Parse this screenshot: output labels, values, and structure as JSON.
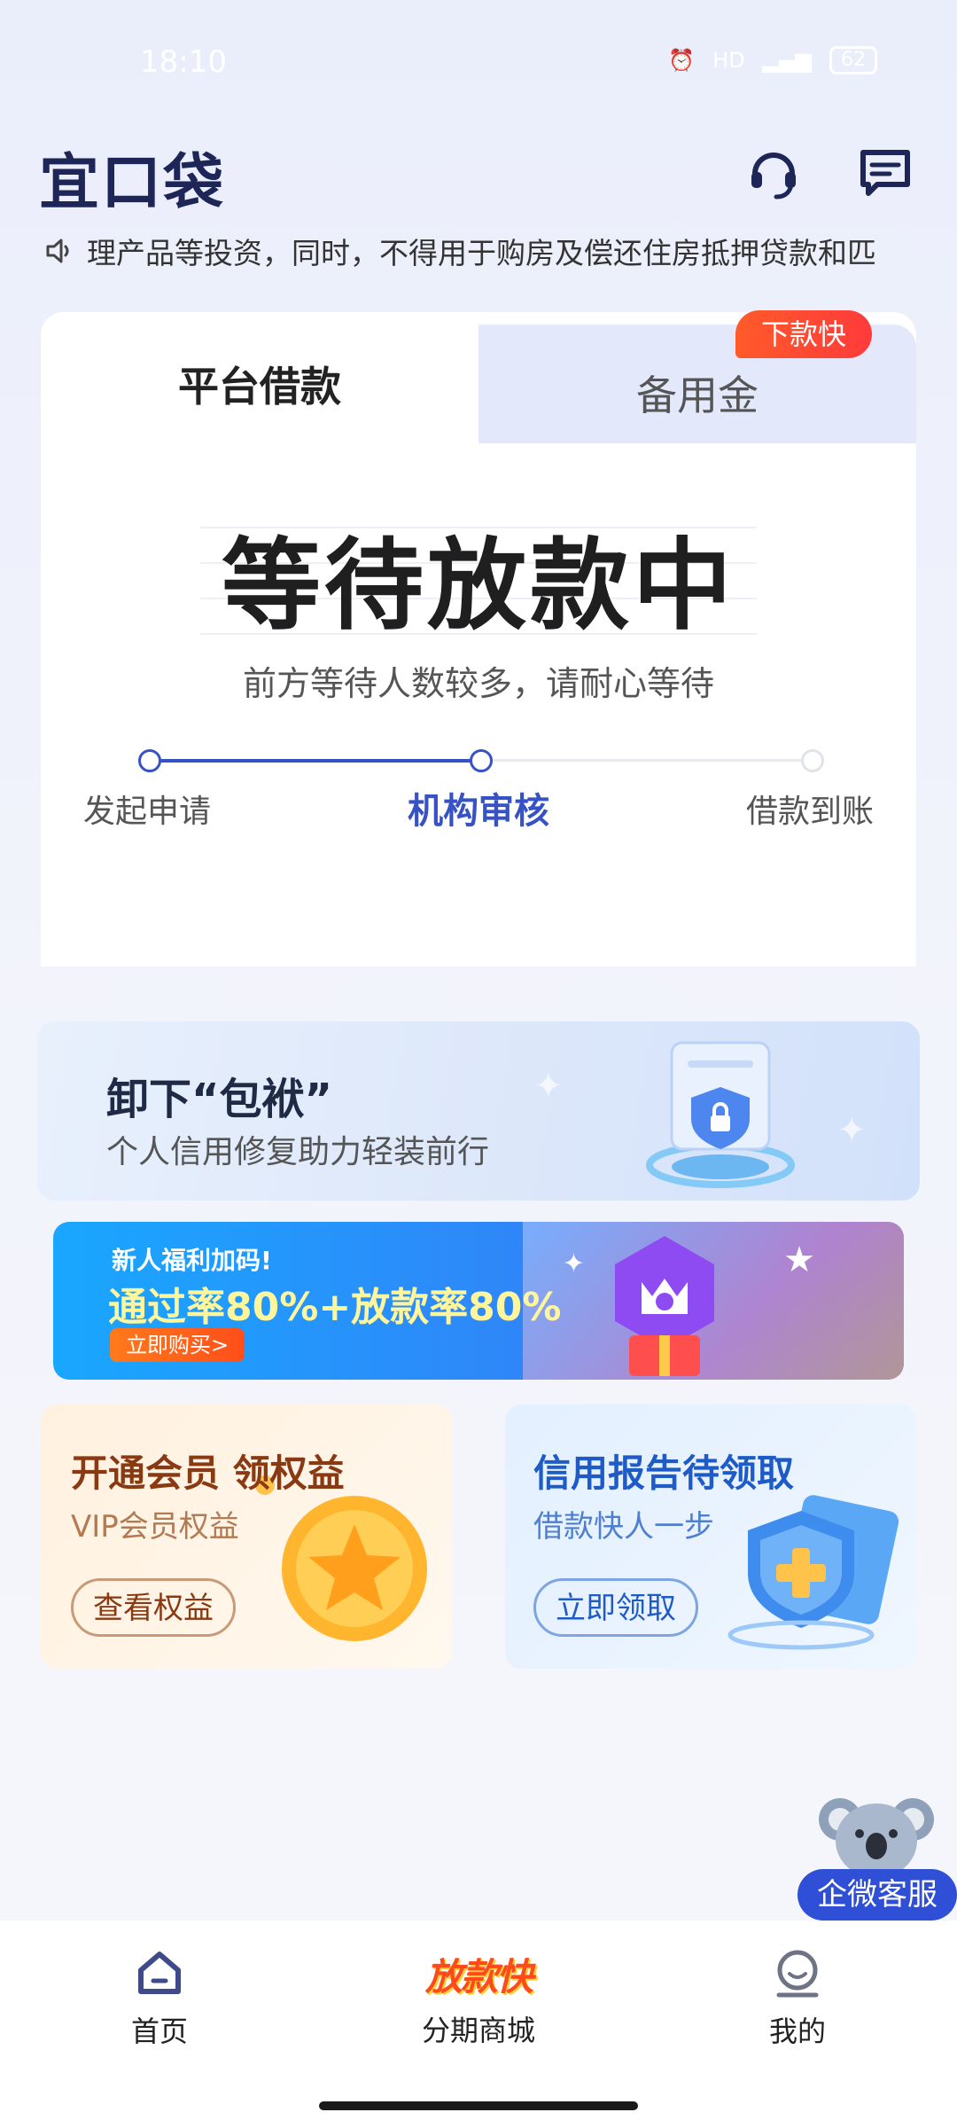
{
  "status_bar": {
    "time": "18:10",
    "battery": "62"
  },
  "header": {
    "logo": "宜口袋"
  },
  "notice": {
    "text": "理产品等投资，同时，不得用于购房及偿还住房抵押贷款和匹"
  },
  "loan_card": {
    "tabs": [
      {
        "label": "平台借款"
      },
      {
        "label": "备用金"
      }
    ],
    "badge": "下款快",
    "status_title": "等待放款中",
    "status_sub": "前方等待人数较多，请耐心等待",
    "steps": [
      {
        "label": "发起申请"
      },
      {
        "label": "机构审核"
      },
      {
        "label": "借款到账"
      }
    ]
  },
  "banner_credit_repair": {
    "title": "卸下“包袱”",
    "subtitle": "个人信用修复助力轻装前行"
  },
  "banner_promo": {
    "small": "新人福利加码!",
    "big": "通过率80%+放款率80%",
    "button": "立即购买>"
  },
  "vip_card": {
    "title": "开通会员 领权益",
    "subtitle": "VIP会员权益",
    "button": "查看权益"
  },
  "credit_card": {
    "title": "信用报告待领取",
    "subtitle": "借款快人一步",
    "button": "立即领取"
  },
  "floating_service": {
    "label": "企微客服"
  },
  "bottom_nav": {
    "items": [
      {
        "label": "首页"
      },
      {
        "label": "分期商城",
        "logo_text": "放款快"
      },
      {
        "label": "我的"
      }
    ]
  },
  "colors": {
    "primary": "#3652C5",
    "accent": "#FF4A1C",
    "nav_dark": "#1E2657"
  }
}
